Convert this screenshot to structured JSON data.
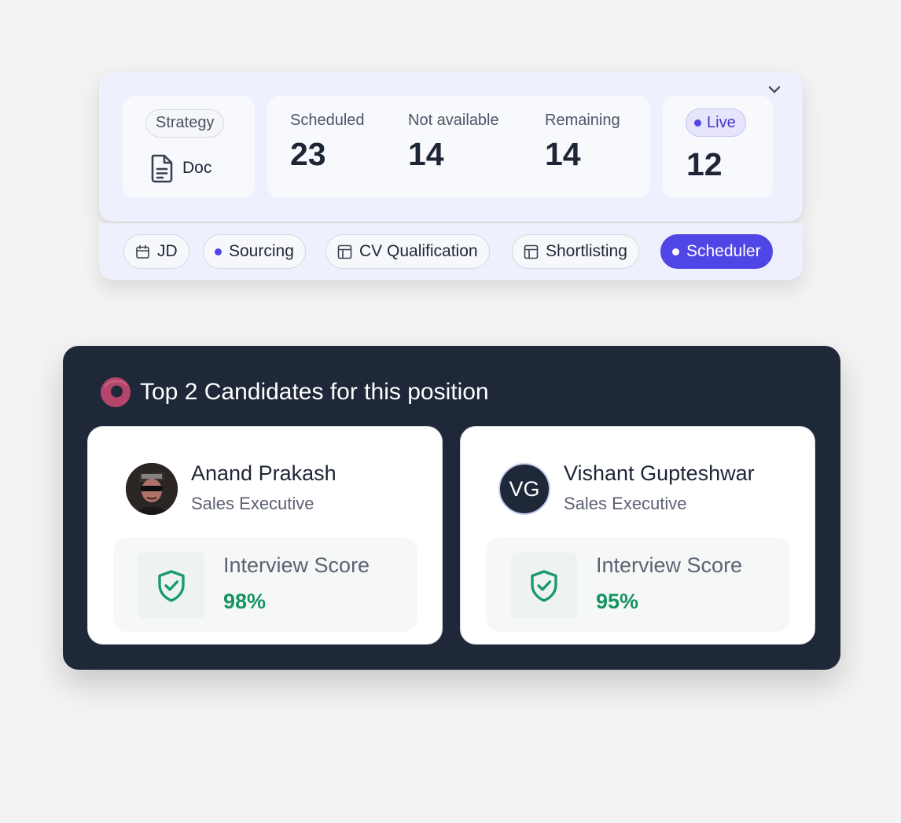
{
  "overview": {
    "strategy": {
      "tag": "Strategy",
      "doc_label": "Doc"
    },
    "stats": [
      {
        "label": "Scheduled",
        "value": "23"
      },
      {
        "label": "Not available",
        "value": "14"
      },
      {
        "label": "Remaining",
        "value": "14"
      }
    ],
    "live": {
      "label": "Live",
      "value": "12"
    }
  },
  "pipeline": {
    "stages": [
      {
        "label": "JD",
        "icon": "calendar-icon"
      },
      {
        "label": "Sourcing",
        "icon": "dot-icon"
      },
      {
        "label": "CV Qualification",
        "icon": "table-icon"
      },
      {
        "label": "Shortlisting",
        "icon": "table-icon"
      },
      {
        "label": "Scheduler",
        "icon": "dot-icon",
        "active": true
      }
    ]
  },
  "candidates": {
    "title": "Top 2 Candidates for this position",
    "score_label": "Interview Score",
    "items": [
      {
        "name": "Anand Prakash",
        "role": "Sales Executive",
        "score": "98%",
        "avatar": "photo"
      },
      {
        "name": "Vishant Gupteshwar",
        "role": "Sales Executive",
        "score": "95%",
        "initials": "VG"
      }
    ]
  },
  "colors": {
    "accent": "#4f46e5",
    "panel_dark": "#1f2838",
    "score_green": "#159463",
    "shield_green": "#1a9a6a",
    "logo_pink": "#b4466b"
  }
}
